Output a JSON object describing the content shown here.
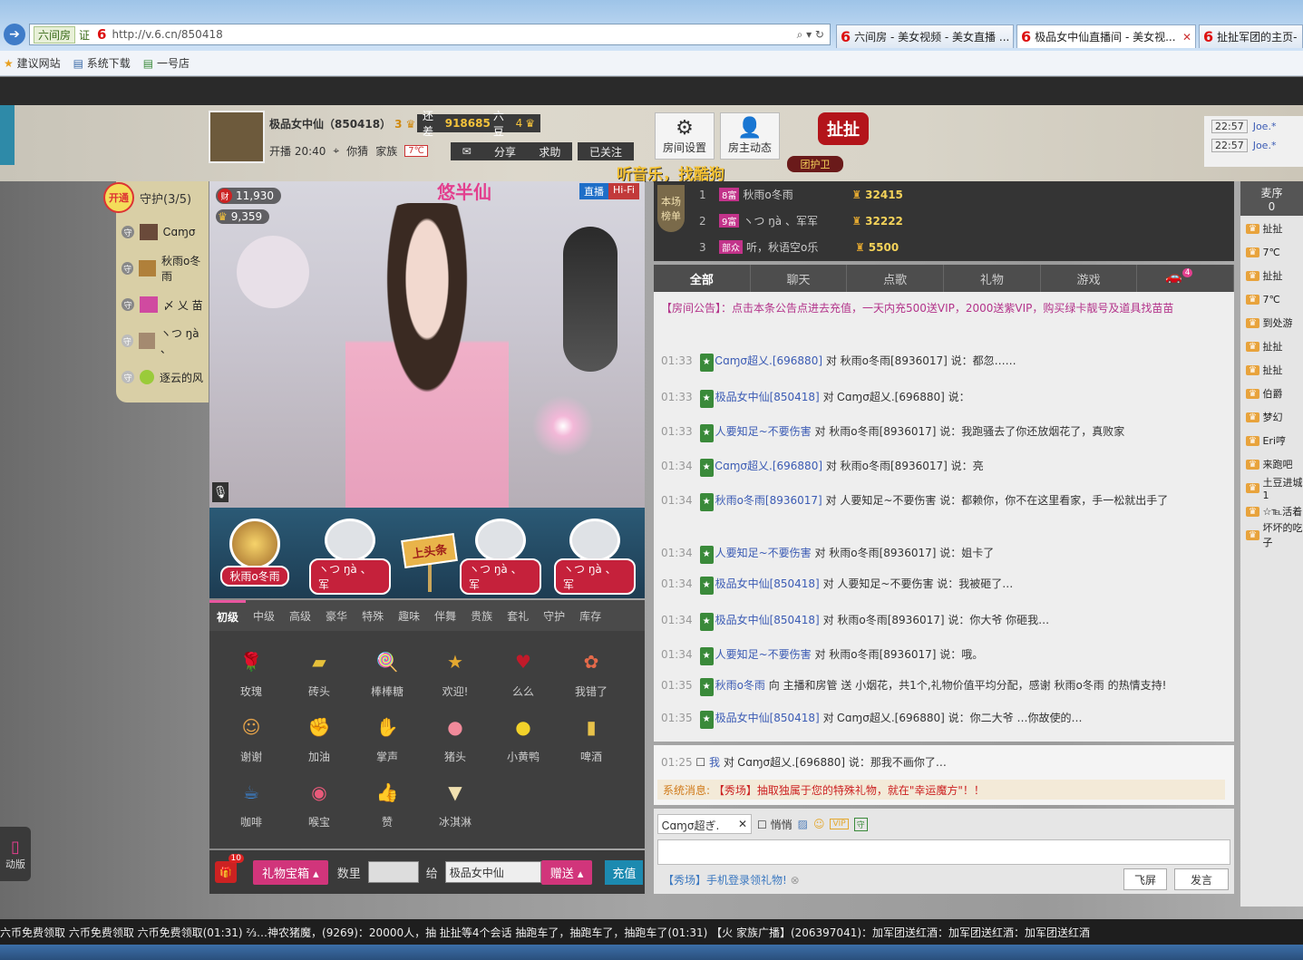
{
  "browser": {
    "zone": "六间房",
    "cert": "证",
    "url": "http://v.6.cn/850418",
    "tabs": [
      {
        "label": "六间房 - 美女视频 - 美女直播 ..."
      },
      {
        "label": "极品女中仙直播间 - 美女视..."
      },
      {
        "label": "扯扯军团的主页-"
      }
    ],
    "favorites": [
      "建议网站",
      "系统下载",
      "一号店"
    ]
  },
  "room": {
    "host_name": "极品女中仙（850418）",
    "host_level": "3",
    "gap_prefix": "还差",
    "gap_value": "918685",
    "gap_suffix": "六豆",
    "gap_level": "4",
    "start_time": "开播 20:40",
    "location": "你猜",
    "family_label": "家族",
    "family_tag": "7℃",
    "actions": [
      "分享",
      "求助"
    ],
    "follow": "已关注",
    "settings": "房间设置",
    "dynamics": "房主动态",
    "slogan": "听音乐，找酷狗",
    "brand_badge": "扯扯",
    "guard_badge": "团护卫",
    "wealth": "11,930",
    "fans": "9,359",
    "live_tag": "直播",
    "hifi_tag": "Hi-Fi",
    "title_overlay": "悠半仙"
  },
  "guard": {
    "open_btn": "开通",
    "title": "守护(3/5)",
    "items": [
      {
        "name": "Ꮯɑɱσ"
      },
      {
        "name": "秋雨o冬雨"
      },
      {
        "name": "〆 乂 苗"
      },
      {
        "name": "ヽつ ŋà 、"
      },
      {
        "name": "逐云的风"
      }
    ]
  },
  "seats": [
    {
      "name": "秋雨o冬雨"
    },
    {
      "name": "ヽつ ŋà 、军"
    },
    {
      "name": "上头条"
    },
    {
      "name": "ヽつ ŋà 、军"
    },
    {
      "name": "ヽつ ŋà 、军"
    }
  ],
  "gift_tabs": [
    "初级",
    "中级",
    "高级",
    "豪华",
    "特殊",
    "趣味",
    "伴舞",
    "贵族",
    "套礼",
    "守护",
    "库存"
  ],
  "gifts": [
    {
      "label": "玫瑰",
      "icon": "🌹",
      "color": "#c2233a"
    },
    {
      "label": "砖头",
      "icon": "▰",
      "color": "#e6c03a"
    },
    {
      "label": "棒棒糖",
      "icon": "🍭",
      "color": "#e0506a"
    },
    {
      "label": "欢迎!",
      "icon": "★",
      "color": "#e3a830"
    },
    {
      "label": "么么",
      "icon": "♥",
      "color": "#c21a2a"
    },
    {
      "label": "我错了",
      "icon": "✿",
      "color": "#e66a4a"
    },
    {
      "label": "谢谢",
      "icon": "☺",
      "color": "#e3a24a"
    },
    {
      "label": "加油",
      "icon": "✊",
      "color": "#e27a30"
    },
    {
      "label": "掌声",
      "icon": "✋",
      "color": "#f0b070"
    },
    {
      "label": "猪头",
      "icon": "●",
      "color": "#f08a9a"
    },
    {
      "label": "小黄鸭",
      "icon": "●",
      "color": "#f2d22a"
    },
    {
      "label": "啤酒",
      "icon": "▮",
      "color": "#e8c24a"
    },
    {
      "label": "咖啡",
      "icon": "☕",
      "color": "#3a8ae0"
    },
    {
      "label": "喉宝",
      "icon": "◉",
      "color": "#e85a7a"
    },
    {
      "label": "赞",
      "icon": "👍",
      "color": "#eaeaea"
    },
    {
      "label": "冰淇淋",
      "icon": "▼",
      "color": "#f0e0b0"
    }
  ],
  "giftbar": {
    "box": "礼物宝箱",
    "qty_label": "数里",
    "to_label": "给",
    "to_value": "极品女中仙",
    "send": "赠送",
    "recharge": "充值",
    "badge": "10"
  },
  "rank": {
    "tab_label": "本场榜单",
    "rows": [
      {
        "pos": "1",
        "lvl": "8富",
        "name": "秋雨o冬雨",
        "score": "32415"
      },
      {
        "pos": "2",
        "lvl": "9富",
        "name": "ヽつ ŋà 、军军",
        "score": "32222"
      },
      {
        "pos": "3",
        "lvl": "部众",
        "name": "听，秋语空o乐",
        "score": "5500"
      }
    ]
  },
  "chat_tabs": [
    "全部",
    "聊天",
    "点歌",
    "礼物",
    "游戏"
  ],
  "chat_car_count": "4",
  "chat": [
    {
      "time": "",
      "text": "【房间公告】：点击本条公告点进去充值，一天内充500送VIP，2000送紫VIP，购买绿卡靓号及道具找苗苗"
    },
    {
      "time": "01:33",
      "user": "Ꮯɑɱσ超乂.[696880]",
      "text": "对 秋雨o冬雨[8936017] 说：都忽……"
    },
    {
      "time": "01:33",
      "user": "极品女中仙[850418]",
      "text": "对 Ꮯɑɱσ超乂.[696880] 说："
    },
    {
      "time": "01:33",
      "user": "人要知足~不要伤害",
      "text": "对 秋雨o冬雨[8936017] 说：我跑骚去了你还放烟花了，真败家"
    },
    {
      "time": "01:34",
      "user": "Ꮯɑɱσ超乂.[696880]",
      "text": "对 秋雨o冬雨[8936017] 说：亮"
    },
    {
      "time": "01:34",
      "user": "秋雨o冬雨[8936017]",
      "text": "对 人要知足~不要伤害 说：都赖你，你不在这里看家，手一松就出手了"
    },
    {
      "time": "01:34",
      "user": "人要知足~不要伤害",
      "text": "对 秋雨o冬雨[8936017] 说：姐卡了"
    },
    {
      "time": "01:34",
      "user": "极品女中仙[850418]",
      "text": "对 人要知足~不要伤害 说：我被砸了…"
    },
    {
      "time": "01:34",
      "user": "极品女中仙[850418]",
      "text": "对 秋雨o冬雨[8936017] 说：你大爷 你砸我…"
    },
    {
      "time": "01:34",
      "user": "人要知足~不要伤害",
      "text": "对 秋雨o冬雨[8936017] 说：哦。"
    },
    {
      "time": "01:35",
      "user": "秋雨o冬雨",
      "text": "向 主播和房管 送 小烟花，共1个,礼物价值平均分配，感谢 秋雨o冬雨 的热情支持!"
    },
    {
      "time": "01:35",
      "user": "极品女中仙[850418]",
      "text": "对 Ꮯɑɱσ超乂.[696880] 说：你二大爷 …你故使的…"
    }
  ],
  "private": {
    "time": "01:25",
    "me": "我",
    "to": "对 Ꮯɑɱσ超乂.[696880] 说：那我不画你了…",
    "sys_label": "系统消息:",
    "sys_text": "【秀场】抽取独属于您的特殊礼物，就在\"幸运魔方\"！！"
  },
  "input": {
    "target": "Ꮯɑɱσ超ぎ.",
    "whisper": "悄悄",
    "notice": "【秀场】手机登录领礼物!",
    "fly": "飞屏",
    "send": "发言"
  },
  "rightcol": {
    "title": "麦序",
    "count": "0",
    "times": [
      {
        "t": "22:57",
        "n": "Joe.*"
      },
      {
        "t": "22:57",
        "n": "Joe.*"
      }
    ],
    "items": [
      "扯扯",
      "7℃",
      "扯扯",
      "7℃",
      "到处游",
      "扯扯",
      "扯扯",
      "伯爵",
      "梦幻",
      "Eri哼",
      "来跑吧",
      "土豆进城1",
      "☆℡活着",
      "坏坏的吃子"
    ]
  },
  "ticker": "六币免费领取  六币免费领取  六币免费领取(01:31)  ⅔…神农猪魔，(9269)：20000人，抽  扯扯等4个会话  抽跑车了，抽跑车了，抽跑车了(01:31)  【火 家族广播】(206397041)：加军团送红酒：加军团送红酒：加军团送红酒",
  "left_mobile": "动版"
}
